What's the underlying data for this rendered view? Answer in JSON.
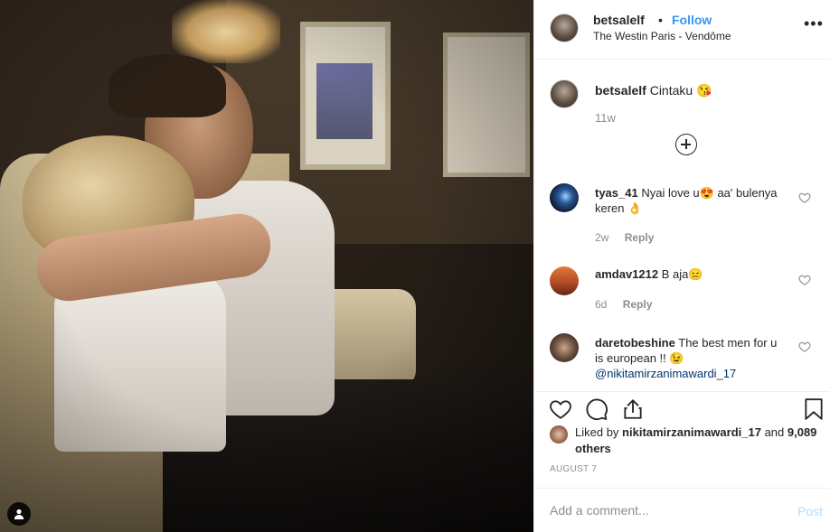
{
  "header": {
    "username": "betsalelf",
    "dot": "•",
    "follow_label": "Follow",
    "location": "The Westin Paris - Vendôme",
    "more_icon": "more-horizontal-icon"
  },
  "caption": {
    "username": "betsalelf",
    "text": "Cintaku 😘",
    "time": "11w"
  },
  "comments": [
    {
      "username": "tyas_41",
      "text": "Nyai love u😍 aa' bulenya keren 👌",
      "time": "2w",
      "reply": "Reply"
    },
    {
      "username": "amdav1212",
      "text": "B aja😑",
      "time": "6d",
      "reply": "Reply"
    },
    {
      "username": "daretobeshine",
      "text": "The best men for u is european !! 😉",
      "mention": "@nikitamirzanimawardi_17"
    }
  ],
  "likes": {
    "prefix": "Liked by ",
    "user": "nikitamirzanimawardi_17",
    "middle": " and ",
    "count": "9,089 others"
  },
  "date": "AUGUST 7",
  "add_comment": {
    "placeholder": "Add a comment...",
    "post_label": "Post"
  },
  "colors": {
    "accent": "#3897f0",
    "post_disabled": "#b2dffc",
    "muted": "#8e8e8e",
    "text": "#262626"
  }
}
